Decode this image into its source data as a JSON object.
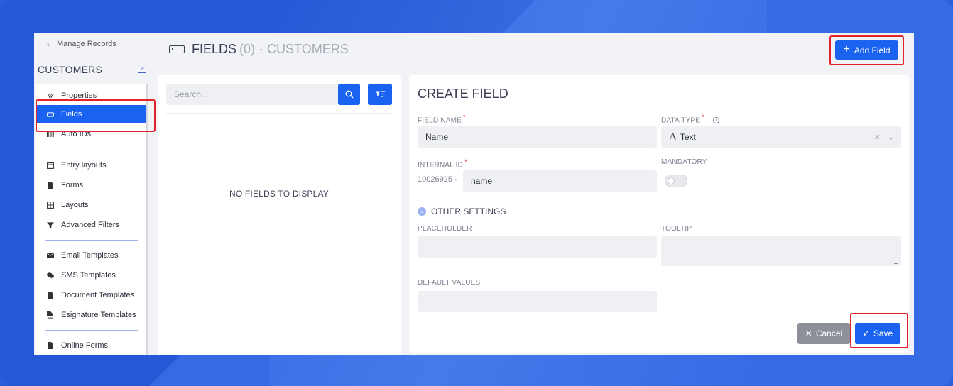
{
  "sidebar": {
    "back_label": "Manage Records",
    "entity_title": "CUSTOMERS",
    "items": [
      {
        "label": "Properties",
        "icon": "gear-icon"
      },
      {
        "label": "Fields",
        "icon": "field-icon",
        "active": true
      },
      {
        "label": "Auto IDs",
        "icon": "barcode-icon"
      },
      {
        "label": "Entry layouts",
        "icon": "layout-icon"
      },
      {
        "label": "Forms",
        "icon": "document-icon"
      },
      {
        "label": "Layouts",
        "icon": "grid-icon"
      },
      {
        "label": "Advanced Filters",
        "icon": "filter-icon"
      },
      {
        "label": "Email Templates",
        "icon": "envelope-icon"
      },
      {
        "label": "SMS Templates",
        "icon": "chat-icon"
      },
      {
        "label": "Document Templates",
        "icon": "document-icon"
      },
      {
        "label": "Esignature Templates",
        "icon": "signature-icon"
      },
      {
        "label": "Online Forms",
        "icon": "document-icon"
      }
    ]
  },
  "header": {
    "title": "FIELDS",
    "count": "(0)",
    "subtitle": "- CUSTOMERS",
    "add_field_label": "Add Field"
  },
  "list": {
    "search_placeholder": "Search...",
    "empty_message": "NO FIELDS TO DISPLAY"
  },
  "form": {
    "title": "CREATE FIELD",
    "field_name_label": "FIELD NAME",
    "field_name_value": "Name",
    "data_type_label": "DATA TYPE",
    "data_type_value": "Text",
    "internal_id_label": "INTERNAL ID",
    "internal_id_prefix": "10026925 -",
    "internal_id_value": "name",
    "mandatory_label": "MANDATORY",
    "mandatory_on": false,
    "other_settings_label": "OTHER SETTINGS",
    "placeholder_label": "PLACEHOLDER",
    "placeholder_value": "",
    "tooltip_label": "TOOLTIP",
    "tooltip_value": "",
    "default_values_label": "DEFAULT VALUES",
    "default_values_value": "",
    "cancel_label": "Cancel",
    "save_label": "Save"
  },
  "colors": {
    "primary": "#1a63f0",
    "highlight": "#e3222b",
    "background": "#2658d6"
  }
}
